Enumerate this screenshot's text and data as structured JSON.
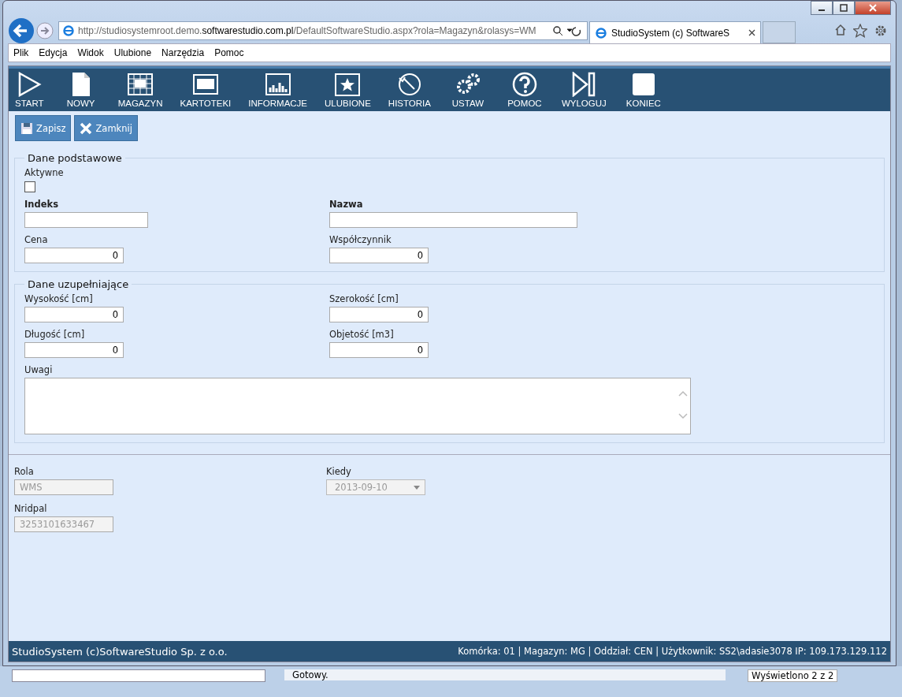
{
  "browser": {
    "address": "http://studiosystemroot.demo.**softwarestudio.com.pl**/DefaultSoftwareStudio.aspx?rola=Magazyn&rolasys=WM",
    "tab_title": "StudioSystem (c) SoftwareS",
    "menu": [
      "Plik",
      "Edycja",
      "Widok",
      "Ulubione",
      "Narzędzia",
      "Pomoc"
    ]
  },
  "toolbar": [
    {
      "label": "START",
      "kind": "play"
    },
    {
      "label": "NOWY",
      "kind": "page"
    },
    {
      "label": "MAGAZYN",
      "kind": "grid"
    },
    {
      "label": "KARTOTEKI",
      "kind": "window"
    },
    {
      "label": "INFORMACJE",
      "kind": "chart"
    },
    {
      "label": "ULUBIONE",
      "kind": "star"
    },
    {
      "label": "HISTORIA",
      "kind": "history"
    },
    {
      "label": "USTAW",
      "kind": "gears"
    },
    {
      "label": "POMOC",
      "kind": "help"
    },
    {
      "label": "WYLOGUJ",
      "kind": "logout"
    },
    {
      "label": "KONIEC",
      "kind": "stop"
    }
  ],
  "actions": [
    {
      "label": "Zapisz",
      "kind": "save"
    },
    {
      "label": "Zamknij",
      "kind": "close"
    }
  ],
  "sections": [
    {
      "title": "Dane podstawowe",
      "checkbox": {
        "label": "Aktywne",
        "checked": false
      },
      "fields": [
        {
          "label": "Indeks",
          "bold": true,
          "kind": "text"
        },
        {
          "label": "Nazwa",
          "bold": true,
          "kind": "wide"
        },
        {
          "label": "Cena",
          "value": "0",
          "bold": false,
          "kind": "number"
        },
        {
          "label": "Współczynnik",
          "value": "0",
          "bold": false,
          "kind": "number"
        }
      ]
    },
    {
      "title": "Dane uzupełniające",
      "fields": [
        {
          "label": "Wysokość [cm]",
          "value": "0",
          "bold": false,
          "kind": "number"
        },
        {
          "label": "Szerokość [cm]",
          "value": "0",
          "bold": false,
          "kind": "number"
        },
        {
          "label": "Długość [cm]",
          "value": "0",
          "bold": false,
          "kind": "number"
        },
        {
          "label": "Objetość [m3]",
          "value": "0",
          "bold": false,
          "kind": "number"
        },
        {
          "label": "Uwagi",
          "bold": false,
          "kind": "textarea"
        }
      ]
    }
  ],
  "footer_fields": [
    {
      "label": "Rola",
      "value": "WMS",
      "kind": "text",
      "disabled": true
    },
    {
      "label": "Kiedy",
      "value": "2013-09-10",
      "kind": "select",
      "disabled": true
    },
    {
      "label": "Nridpal",
      "value": "3253101633467",
      "kind": "text",
      "disabled": true
    }
  ],
  "status_bar": {
    "left": "StudioSystem (c)SoftwareStudio Sp. z o.o.",
    "right": "Komórka: 01 | Magazyn: MG | Oddział: CEN | Użytkownik: SS2\\adasie3078 IP: 109.173.129.112"
  },
  "background_window": {
    "status": "Gotowy.",
    "count": "Wyświetlono 2 z 2"
  }
}
